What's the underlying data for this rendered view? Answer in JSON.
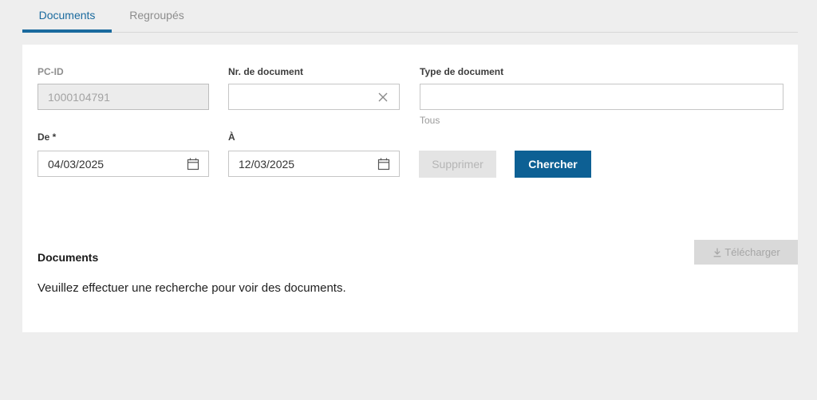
{
  "colors": {
    "page_bg": "#eeeeee",
    "card_bg": "#ffffff",
    "tab_active_blue": "#1a6a9e",
    "tab_inactive_gray": "#8d8d8d",
    "primary_button_blue": "#0d6094",
    "disabled_button_bg": "#e4e4e4",
    "download_button_bg": "#d9d9d9",
    "input_border": "#c6c6c6"
  },
  "tabs": [
    {
      "label": "Documents",
      "active": true
    },
    {
      "label": "Regroupés",
      "active": false
    }
  ],
  "form": {
    "pc_id": {
      "label": "PC-ID",
      "value": "1000104791",
      "disabled": true
    },
    "doc_number": {
      "label": "Nr. de document",
      "value": "",
      "clear_icon": "x-clear-icon"
    },
    "doc_type": {
      "label": "Type de document",
      "value": "",
      "hint": "Tous"
    },
    "date_from": {
      "label": "De *",
      "value": "04/03/2025",
      "icon": "calendar-icon"
    },
    "date_to": {
      "label": "À",
      "value": "12/03/2025",
      "icon": "calendar-icon"
    },
    "delete_button_label": "Supprimer",
    "search_button_label": "Chercher"
  },
  "results": {
    "heading": "Documents",
    "empty_message": "Veuillez effectuer une recherche pour voir des documents.",
    "download_button_label": "Télécharger",
    "download_icon": "download-icon"
  }
}
